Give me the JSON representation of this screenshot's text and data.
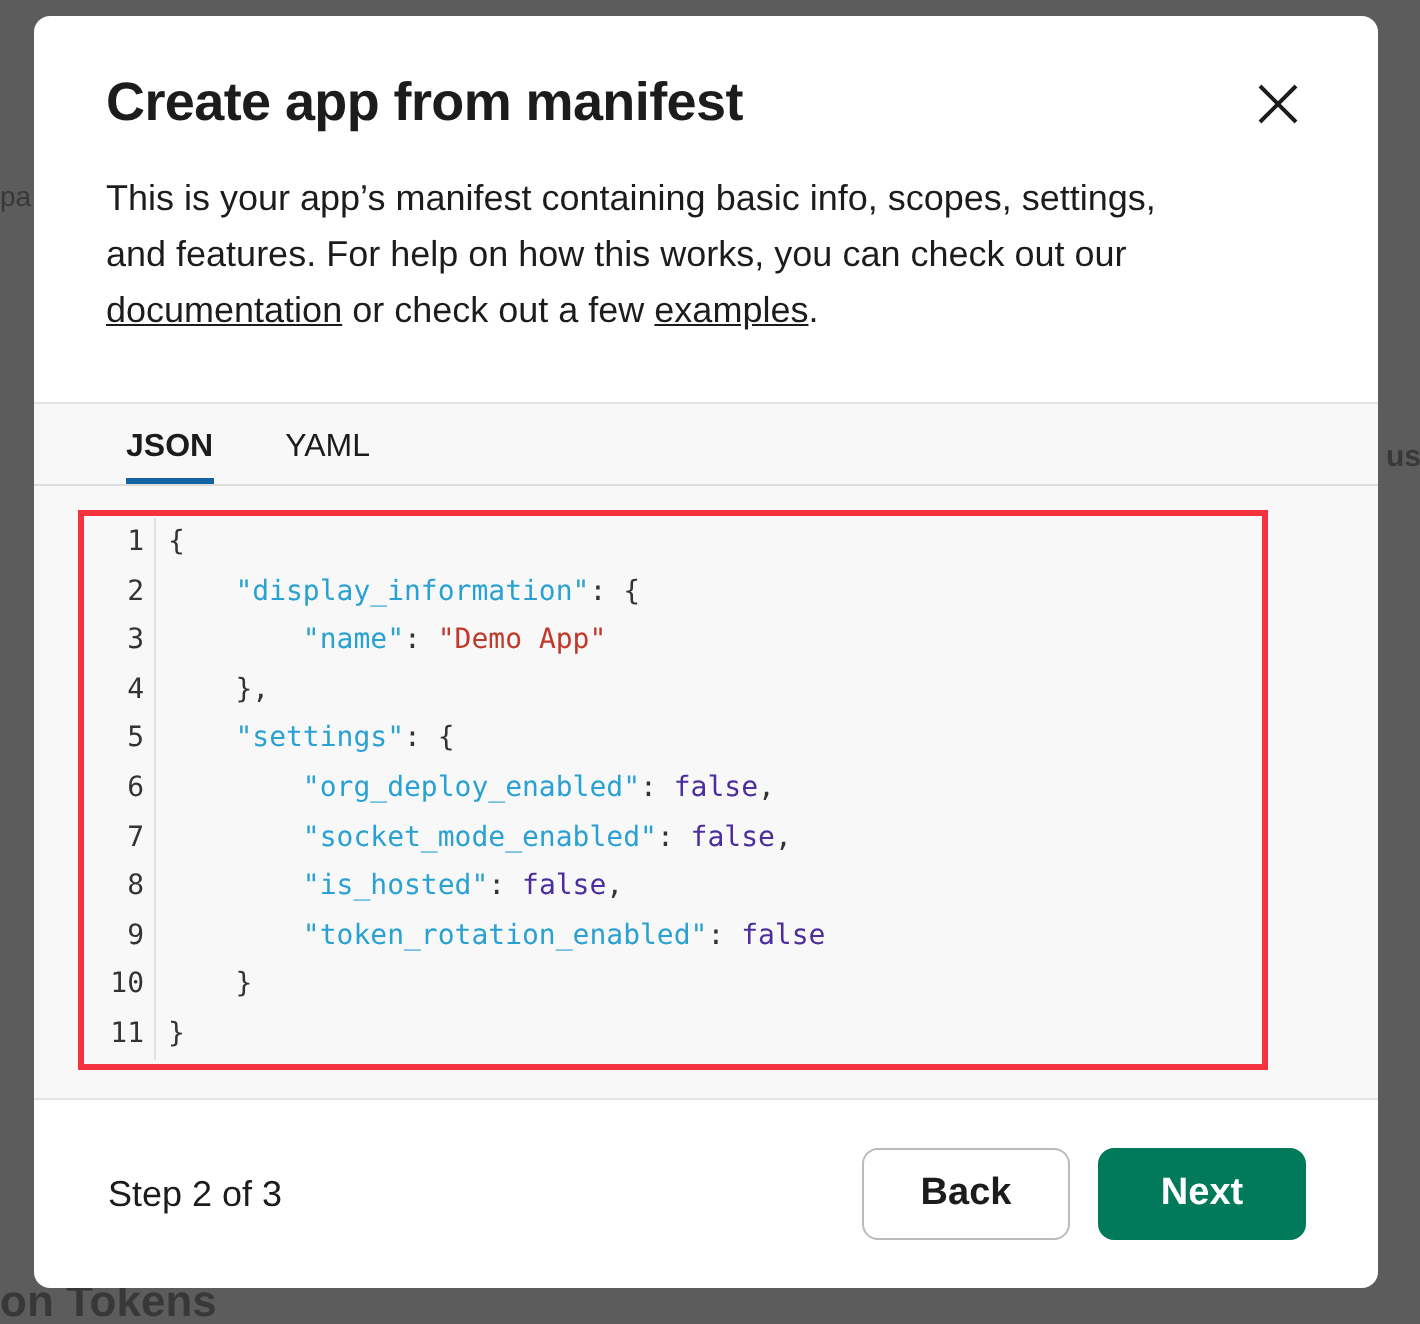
{
  "backdrop": {
    "fragments": [
      {
        "kind": "left",
        "text": "pa"
      },
      {
        "kind": "right",
        "text": "us"
      },
      {
        "kind": "bottom",
        "text": "on Tokens"
      }
    ]
  },
  "dialog": {
    "title": "Create app from manifest",
    "description": [
      {
        "kind": "text",
        "text": "This is your app’s manifest containing basic info, scopes, settings, and features. For help on how this works, you can check out our "
      },
      {
        "kind": "link",
        "text": "documentation"
      },
      {
        "kind": "text",
        "text": " or check out a few "
      },
      {
        "kind": "link",
        "text": "examples"
      },
      {
        "kind": "text",
        "text": "."
      }
    ],
    "tabs": [
      {
        "label": "JSON",
        "selected": true
      },
      {
        "label": "YAML",
        "selected": false
      }
    ],
    "editor": {
      "highlighted": true,
      "lines": [
        {
          "number": "1",
          "tokens": [
            {
              "kind": "plain",
              "text": "{"
            }
          ]
        },
        {
          "number": "2",
          "tokens": [
            {
              "kind": "key",
              "text": "    \"display_information\""
            },
            {
              "kind": "plain",
              "text": ": {"
            }
          ]
        },
        {
          "number": "3",
          "tokens": [
            {
              "kind": "key",
              "text": "        \"name\""
            },
            {
              "kind": "plain",
              "text": ": "
            },
            {
              "kind": "string",
              "text": "\"Demo App\""
            }
          ]
        },
        {
          "number": "4",
          "tokens": [
            {
              "kind": "plain",
              "text": "    },"
            }
          ]
        },
        {
          "number": "5",
          "tokens": [
            {
              "kind": "key",
              "text": "    \"settings\""
            },
            {
              "kind": "plain",
              "text": ": {"
            }
          ]
        },
        {
          "number": "6",
          "tokens": [
            {
              "kind": "key",
              "text": "        \"org_deploy_enabled\""
            },
            {
              "kind": "plain",
              "text": ": "
            },
            {
              "kind": "bool",
              "text": "false"
            },
            {
              "kind": "plain",
              "text": ","
            }
          ]
        },
        {
          "number": "7",
          "tokens": [
            {
              "kind": "key",
              "text": "        \"socket_mode_enabled\""
            },
            {
              "kind": "plain",
              "text": ": "
            },
            {
              "kind": "bool",
              "text": "false"
            },
            {
              "kind": "plain",
              "text": ","
            }
          ]
        },
        {
          "number": "8",
          "tokens": [
            {
              "kind": "key",
              "text": "        \"is_hosted\""
            },
            {
              "kind": "plain",
              "text": ": "
            },
            {
              "kind": "bool",
              "text": "false"
            },
            {
              "kind": "plain",
              "text": ","
            }
          ]
        },
        {
          "number": "9",
          "tokens": [
            {
              "kind": "key",
              "text": "        \"token_rotation_enabled\""
            },
            {
              "kind": "plain",
              "text": ": "
            },
            {
              "kind": "bool",
              "text": "false"
            }
          ]
        },
        {
          "number": "10",
          "tokens": [
            {
              "kind": "plain",
              "text": "    }"
            }
          ]
        },
        {
          "number": "11",
          "tokens": [
            {
              "kind": "plain",
              "text": "}"
            }
          ]
        }
      ]
    },
    "step": "Step 2 of 3",
    "buttons": [
      {
        "kind": "secondary",
        "label": "Back"
      },
      {
        "kind": "primary",
        "label": "Next"
      }
    ]
  }
}
